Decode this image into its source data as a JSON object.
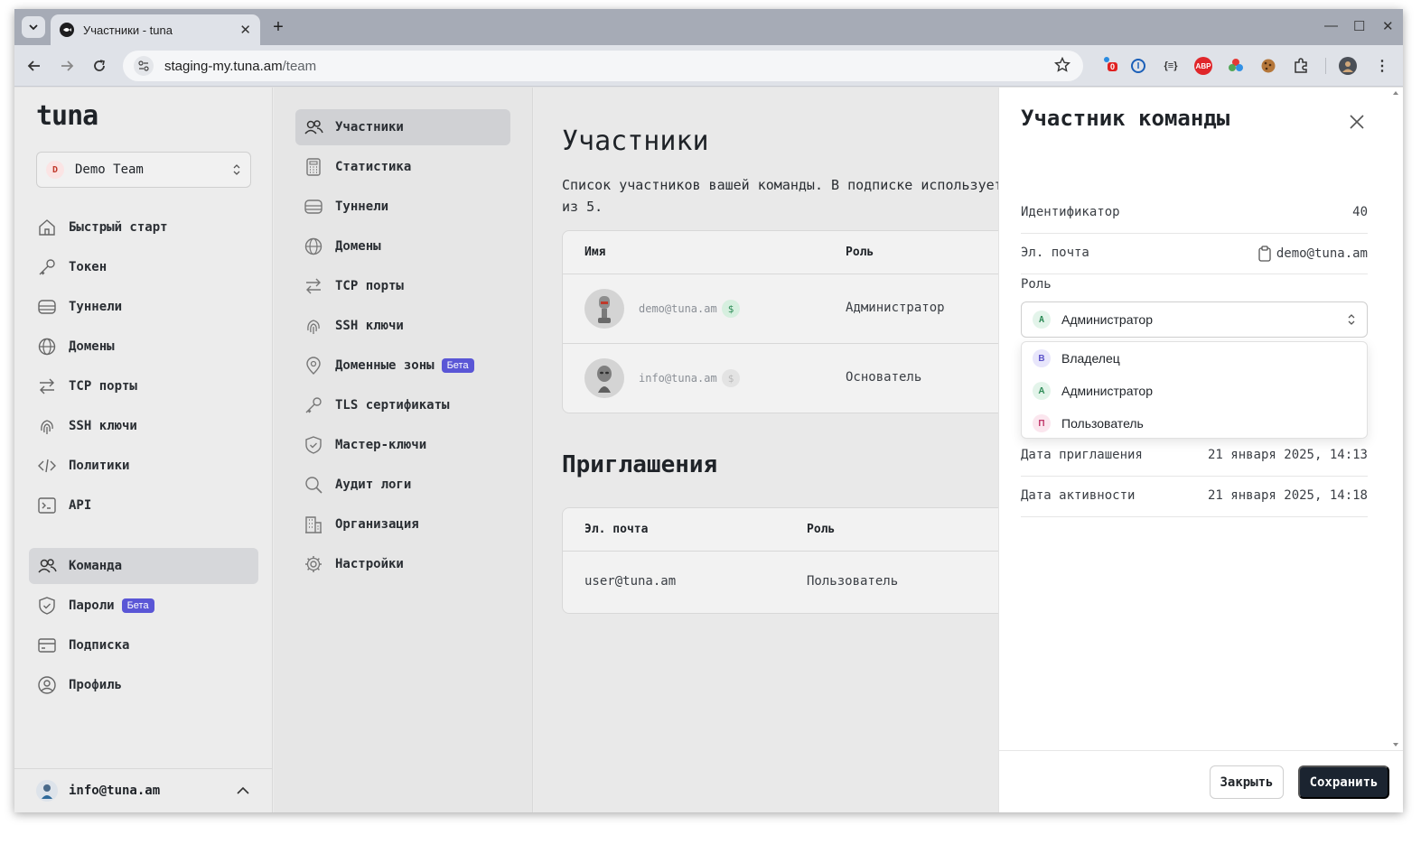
{
  "browser": {
    "tab_title": "Участники - tuna",
    "url_host": "staging-my.tuna.am",
    "url_path": "/team",
    "extensions": [
      "notification-ext-icon",
      "password-manager-icon",
      "json-viewer-icon",
      "adblock-icon",
      "color-picker-icon",
      "cookie-icon",
      "extensions-icon",
      "profile-avatar-icon"
    ],
    "extension_badge": "0",
    "adblock_label": "ABP",
    "json_label": "{≡}"
  },
  "sidebar": {
    "logo": "tuna",
    "team": {
      "initial": "D",
      "name": "Demo Team"
    },
    "items": [
      {
        "label": "Быстрый старт",
        "icon": "home-icon"
      },
      {
        "label": "Токен",
        "icon": "key-icon"
      },
      {
        "label": "Туннели",
        "icon": "tunnel-icon"
      },
      {
        "label": "Домены",
        "icon": "globe-icon"
      },
      {
        "label": "TCP порты",
        "icon": "arrows-icon"
      },
      {
        "label": "SSH ключи",
        "icon": "fingerprint-icon"
      },
      {
        "label": "Политики",
        "icon": "code-icon"
      },
      {
        "label": "API",
        "icon": "terminal-icon"
      }
    ],
    "items2": [
      {
        "label": "Команда",
        "icon": "users-icon",
        "active": true
      },
      {
        "label": "Пароли",
        "icon": "shield-icon",
        "badge": "Бета"
      },
      {
        "label": "Подписка",
        "icon": "card-icon"
      },
      {
        "label": "Профиль",
        "icon": "user-circle-icon"
      }
    ],
    "user_email": "info@tuna.am"
  },
  "subnav": {
    "items": [
      {
        "label": "Участники",
        "icon": "users-icon",
        "active": true
      },
      {
        "label": "Статистика",
        "icon": "calculator-icon"
      },
      {
        "label": "Туннели",
        "icon": "tunnel-icon"
      },
      {
        "label": "Домены",
        "icon": "globe-icon"
      },
      {
        "label": "TCP порты",
        "icon": "arrows-icon"
      },
      {
        "label": "SSH ключи",
        "icon": "fingerprint-icon"
      },
      {
        "label": "Доменные зоны",
        "icon": "pin-icon",
        "badge": "Бета"
      },
      {
        "label": "TLS сертификаты",
        "icon": "key-icon"
      },
      {
        "label": "Мастер-ключи",
        "icon": "shield-check-icon"
      },
      {
        "label": "Аудит логи",
        "icon": "search-icon"
      },
      {
        "label": "Организация",
        "icon": "building-icon"
      },
      {
        "label": "Настройки",
        "icon": "gear-icon"
      }
    ]
  },
  "main": {
    "title": "Участники",
    "description_line1": "Список участников вашей команды. В подписке используется",
    "description_line2": "из 5.",
    "members_table": {
      "headers": [
        "Имя",
        "Роль"
      ],
      "rows": [
        {
          "email": "demo@tuna.am",
          "role": "Администратор",
          "paid": true,
          "dollar": "$"
        },
        {
          "email": "info@tuna.am",
          "role": "Основатель",
          "paid": false,
          "dollar": "$"
        }
      ]
    },
    "invites_title": "Приглашения",
    "invites_table": {
      "headers": [
        "Эл. почта",
        "Роль"
      ],
      "rows": [
        {
          "email": "user@tuna.am",
          "role": "Пользователь"
        }
      ]
    }
  },
  "drawer": {
    "title": "Участник команды",
    "id_label": "Идентификатор",
    "id_value": "40",
    "email_label": "Эл. почта",
    "email_value": "demo@tuna.am",
    "role_label": "Роль",
    "role_selected": {
      "initial": "А",
      "label": "Администратор"
    },
    "role_options": [
      {
        "initial": "В",
        "label": "Владелец",
        "color": "#5b53c9",
        "bg": "#e8e6fb"
      },
      {
        "initial": "А",
        "label": "Администратор",
        "color": "#2e8b57",
        "bg": "#e3f4ea"
      },
      {
        "initial": "П",
        "label": "Пользователь",
        "color": "#c0396b",
        "bg": "#fbe6ee"
      }
    ],
    "invited_label": "Дата приглашения",
    "invited_value": "21 января 2025, 14:13",
    "active_label": "Дата активности",
    "active_value": "21 января 2025, 14:18",
    "close_btn": "Закрыть",
    "save_btn": "Сохранить"
  },
  "colors": {
    "accent": "#5a56d6",
    "primary_button": "#1b2430",
    "paid_green": "#2e8b57"
  }
}
